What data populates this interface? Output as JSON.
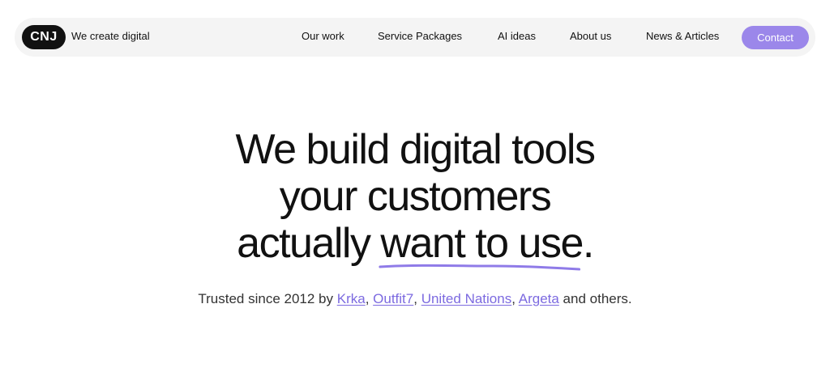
{
  "header": {
    "logo_text": "CNJ",
    "tagline": "We create digital",
    "nav": [
      {
        "label": "Our work"
      },
      {
        "label": "Service Packages"
      },
      {
        "label": "AI ideas"
      },
      {
        "label": "About us"
      },
      {
        "label": "News & Articles"
      }
    ],
    "contact_label": "Contact",
    "accent_color": "#9b87ea"
  },
  "hero": {
    "line1": "We build digital tools",
    "line2": "your customers",
    "line3_prefix": "actually ",
    "line3_highlight": "want to use",
    "line3_suffix": "."
  },
  "trusted": {
    "prefix": "Trusted since 2012 by ",
    "clients": [
      "Krka",
      "Outfit7",
      "United Nations",
      "Argeta"
    ],
    "sep1": ", ",
    "sep2": ", ",
    "sep3": ", ",
    "suffix": " and others."
  }
}
